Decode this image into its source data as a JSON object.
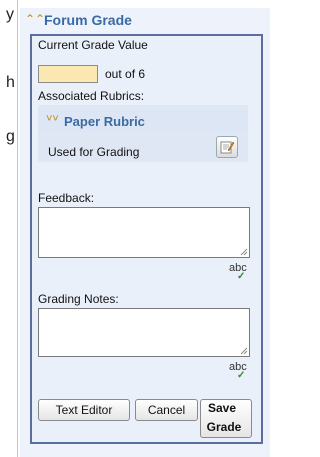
{
  "left_context": {
    "chars": [
      "y",
      "h",
      "g"
    ]
  },
  "header": {
    "title": "Forum Grade"
  },
  "grade": {
    "label": "Current Grade Value",
    "value": "",
    "out_of": "out of 6"
  },
  "rubrics": {
    "label": "Associated Rubrics:",
    "name": "Paper Rubric",
    "status": "Used for Grading"
  },
  "feedback": {
    "label": "Feedback:",
    "value": "",
    "spell_label": "abc"
  },
  "notes": {
    "label": "Grading Notes:",
    "value": "",
    "spell_label": "abc"
  },
  "buttons": {
    "text_editor": "Text Editor",
    "cancel": "Cancel",
    "save_line1": "Save",
    "save_line2": "Grade"
  },
  "colors": {
    "accent": "#3a6aa5",
    "panel_border": "#5c6ea0",
    "input_highlight": "#fbe7b1",
    "chevron": "#c08a10"
  },
  "icons": [
    "chevron-up-double-icon",
    "chevron-down-double-icon",
    "edit-rubric-icon",
    "spellcheck-icon"
  ]
}
